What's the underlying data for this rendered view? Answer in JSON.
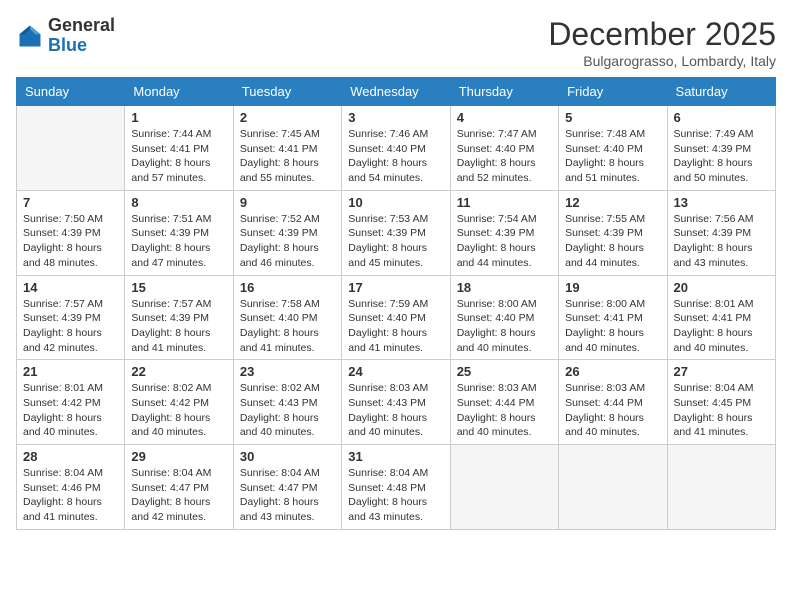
{
  "header": {
    "logo_general": "General",
    "logo_blue": "Blue",
    "month_title": "December 2025",
    "location": "Bulgarograsso, Lombardy, Italy"
  },
  "weekdays": [
    "Sunday",
    "Monday",
    "Tuesday",
    "Wednesday",
    "Thursday",
    "Friday",
    "Saturday"
  ],
  "weeks": [
    [
      {
        "day": "",
        "info": ""
      },
      {
        "day": "1",
        "info": "Sunrise: 7:44 AM\nSunset: 4:41 PM\nDaylight: 8 hours\nand 57 minutes."
      },
      {
        "day": "2",
        "info": "Sunrise: 7:45 AM\nSunset: 4:41 PM\nDaylight: 8 hours\nand 55 minutes."
      },
      {
        "day": "3",
        "info": "Sunrise: 7:46 AM\nSunset: 4:40 PM\nDaylight: 8 hours\nand 54 minutes."
      },
      {
        "day": "4",
        "info": "Sunrise: 7:47 AM\nSunset: 4:40 PM\nDaylight: 8 hours\nand 52 minutes."
      },
      {
        "day": "5",
        "info": "Sunrise: 7:48 AM\nSunset: 4:40 PM\nDaylight: 8 hours\nand 51 minutes."
      },
      {
        "day": "6",
        "info": "Sunrise: 7:49 AM\nSunset: 4:39 PM\nDaylight: 8 hours\nand 50 minutes."
      }
    ],
    [
      {
        "day": "7",
        "info": "Sunrise: 7:50 AM\nSunset: 4:39 PM\nDaylight: 8 hours\nand 48 minutes."
      },
      {
        "day": "8",
        "info": "Sunrise: 7:51 AM\nSunset: 4:39 PM\nDaylight: 8 hours\nand 47 minutes."
      },
      {
        "day": "9",
        "info": "Sunrise: 7:52 AM\nSunset: 4:39 PM\nDaylight: 8 hours\nand 46 minutes."
      },
      {
        "day": "10",
        "info": "Sunrise: 7:53 AM\nSunset: 4:39 PM\nDaylight: 8 hours\nand 45 minutes."
      },
      {
        "day": "11",
        "info": "Sunrise: 7:54 AM\nSunset: 4:39 PM\nDaylight: 8 hours\nand 44 minutes."
      },
      {
        "day": "12",
        "info": "Sunrise: 7:55 AM\nSunset: 4:39 PM\nDaylight: 8 hours\nand 44 minutes."
      },
      {
        "day": "13",
        "info": "Sunrise: 7:56 AM\nSunset: 4:39 PM\nDaylight: 8 hours\nand 43 minutes."
      }
    ],
    [
      {
        "day": "14",
        "info": "Sunrise: 7:57 AM\nSunset: 4:39 PM\nDaylight: 8 hours\nand 42 minutes."
      },
      {
        "day": "15",
        "info": "Sunrise: 7:57 AM\nSunset: 4:39 PM\nDaylight: 8 hours\nand 41 minutes."
      },
      {
        "day": "16",
        "info": "Sunrise: 7:58 AM\nSunset: 4:40 PM\nDaylight: 8 hours\nand 41 minutes."
      },
      {
        "day": "17",
        "info": "Sunrise: 7:59 AM\nSunset: 4:40 PM\nDaylight: 8 hours\nand 41 minutes."
      },
      {
        "day": "18",
        "info": "Sunrise: 8:00 AM\nSunset: 4:40 PM\nDaylight: 8 hours\nand 40 minutes."
      },
      {
        "day": "19",
        "info": "Sunrise: 8:00 AM\nSunset: 4:41 PM\nDaylight: 8 hours\nand 40 minutes."
      },
      {
        "day": "20",
        "info": "Sunrise: 8:01 AM\nSunset: 4:41 PM\nDaylight: 8 hours\nand 40 minutes."
      }
    ],
    [
      {
        "day": "21",
        "info": "Sunrise: 8:01 AM\nSunset: 4:42 PM\nDaylight: 8 hours\nand 40 minutes."
      },
      {
        "day": "22",
        "info": "Sunrise: 8:02 AM\nSunset: 4:42 PM\nDaylight: 8 hours\nand 40 minutes."
      },
      {
        "day": "23",
        "info": "Sunrise: 8:02 AM\nSunset: 4:43 PM\nDaylight: 8 hours\nand 40 minutes."
      },
      {
        "day": "24",
        "info": "Sunrise: 8:03 AM\nSunset: 4:43 PM\nDaylight: 8 hours\nand 40 minutes."
      },
      {
        "day": "25",
        "info": "Sunrise: 8:03 AM\nSunset: 4:44 PM\nDaylight: 8 hours\nand 40 minutes."
      },
      {
        "day": "26",
        "info": "Sunrise: 8:03 AM\nSunset: 4:44 PM\nDaylight: 8 hours\nand 40 minutes."
      },
      {
        "day": "27",
        "info": "Sunrise: 8:04 AM\nSunset: 4:45 PM\nDaylight: 8 hours\nand 41 minutes."
      }
    ],
    [
      {
        "day": "28",
        "info": "Sunrise: 8:04 AM\nSunset: 4:46 PM\nDaylight: 8 hours\nand 41 minutes."
      },
      {
        "day": "29",
        "info": "Sunrise: 8:04 AM\nSunset: 4:47 PM\nDaylight: 8 hours\nand 42 minutes."
      },
      {
        "day": "30",
        "info": "Sunrise: 8:04 AM\nSunset: 4:47 PM\nDaylight: 8 hours\nand 43 minutes."
      },
      {
        "day": "31",
        "info": "Sunrise: 8:04 AM\nSunset: 4:48 PM\nDaylight: 8 hours\nand 43 minutes."
      },
      {
        "day": "",
        "info": ""
      },
      {
        "day": "",
        "info": ""
      },
      {
        "day": "",
        "info": ""
      }
    ]
  ]
}
